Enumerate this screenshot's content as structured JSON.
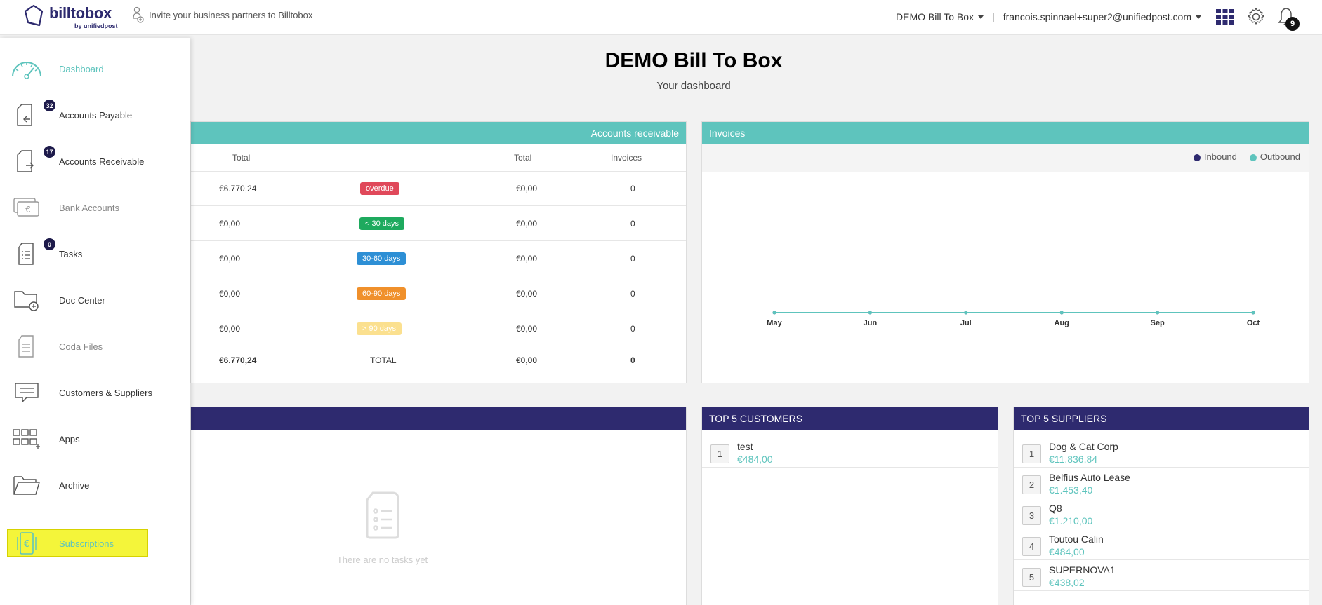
{
  "brand": {
    "name": "billtobox",
    "sub": "by unifiedpost"
  },
  "invite_text": "Invite your business partners to Billtobox",
  "company_selector": "DEMO Bill To Box",
  "separator": "|",
  "user_email": "francois.spinnael+super2@unifiedpost.com",
  "notifications_count": "9",
  "sidebar": [
    {
      "label": "Dashboard",
      "icon": "gauge-icon",
      "badge": "",
      "color": "#5ec4bd"
    },
    {
      "label": "Accounts Payable",
      "icon": "inbound-doc-icon",
      "badge": "32",
      "color": "#333"
    },
    {
      "label": "Accounts Receivable",
      "icon": "outbound-doc-icon",
      "badge": "17",
      "color": "#333"
    },
    {
      "label": "Bank Accounts",
      "icon": "bank-card-icon",
      "badge": "",
      "color": "#888"
    },
    {
      "label": "Tasks",
      "icon": "task-list-icon",
      "badge": "0",
      "color": "#333"
    },
    {
      "label": "Doc Center",
      "icon": "folder-add-icon",
      "badge": "",
      "color": "#333"
    },
    {
      "label": "Coda Files",
      "icon": "file-icon",
      "badge": "",
      "color": "#888"
    },
    {
      "label": "Customers & Suppliers",
      "icon": "chat-icon",
      "badge": "",
      "color": "#333"
    },
    {
      "label": "Apps",
      "icon": "apps-grid-icon",
      "badge": "",
      "color": "#333"
    },
    {
      "label": "Archive",
      "icon": "open-folder-icon",
      "badge": "",
      "color": "#333"
    },
    {
      "label": "Subscriptions",
      "icon": "euro-phone-icon",
      "badge": "",
      "color": "#5ec4bd"
    }
  ],
  "page": {
    "title": "DEMO Bill To Box",
    "subtitle": "Your dashboard"
  },
  "ar": {
    "title": "Accounts receivable",
    "headers": {
      "total_left": "Total",
      "total_right": "Total",
      "invoices": "Invoices"
    },
    "rows": [
      {
        "left": "€6.770,24",
        "status": "overdue",
        "color": "#e0485a",
        "text_color": "#fff",
        "right": "€0,00",
        "invoices": "0"
      },
      {
        "left": "€0,00",
        "status": "< 30 days",
        "color": "#1eaa5e",
        "text_color": "#fff",
        "right": "€0,00",
        "invoices": "0"
      },
      {
        "left": "€0,00",
        "status": "30-60 days",
        "color": "#2d8fd5",
        "text_color": "#fff",
        "right": "€0,00",
        "invoices": "0"
      },
      {
        "left": "€0,00",
        "status": "60-90 days",
        "color": "#f0902b",
        "text_color": "#fff",
        "right": "€0,00",
        "invoices": "0"
      },
      {
        "left": "€0,00",
        "status": "> 90 days",
        "color": "#fbe08f",
        "text_color": "#fff",
        "right": "€0,00",
        "invoices": "0"
      }
    ],
    "total": {
      "left": "€6.770,24",
      "label": "TOTAL",
      "right": "€0,00",
      "invoices": "0"
    }
  },
  "invoices_chart_title": "Invoices",
  "chart_data": {
    "type": "line",
    "title": "Invoices",
    "categories": [
      "May",
      "Jun",
      "Jul",
      "Aug",
      "Sep",
      "Oct"
    ],
    "series": [
      {
        "name": "Inbound",
        "values": [
          0,
          0,
          0,
          0,
          0,
          0
        ],
        "color": "#2e2a6f"
      },
      {
        "name": "Outbound",
        "values": [
          0,
          0,
          0,
          0,
          0,
          0
        ],
        "color": "#5ec4bd"
      }
    ],
    "legend_position": "top-right"
  },
  "tasks_empty": "There are no tasks yet",
  "top_customers": {
    "title": "TOP 5 CUSTOMERS",
    "items": [
      {
        "rank": "1",
        "name": "test",
        "amount": "€484,00"
      }
    ]
  },
  "top_suppliers": {
    "title": "TOP 5 SUPPLIERS",
    "items": [
      {
        "rank": "1",
        "name": "Dog & Cat Corp",
        "amount": "€11.836,84"
      },
      {
        "rank": "2",
        "name": "Belfius Auto Lease",
        "amount": "€1.453,40"
      },
      {
        "rank": "3",
        "name": "Q8",
        "amount": "€1.210,00"
      },
      {
        "rank": "4",
        "name": "Toutou Calin",
        "amount": "€484,00"
      },
      {
        "rank": "5",
        "name": "SUPERNOVA1",
        "amount": "€438,02"
      }
    ]
  }
}
